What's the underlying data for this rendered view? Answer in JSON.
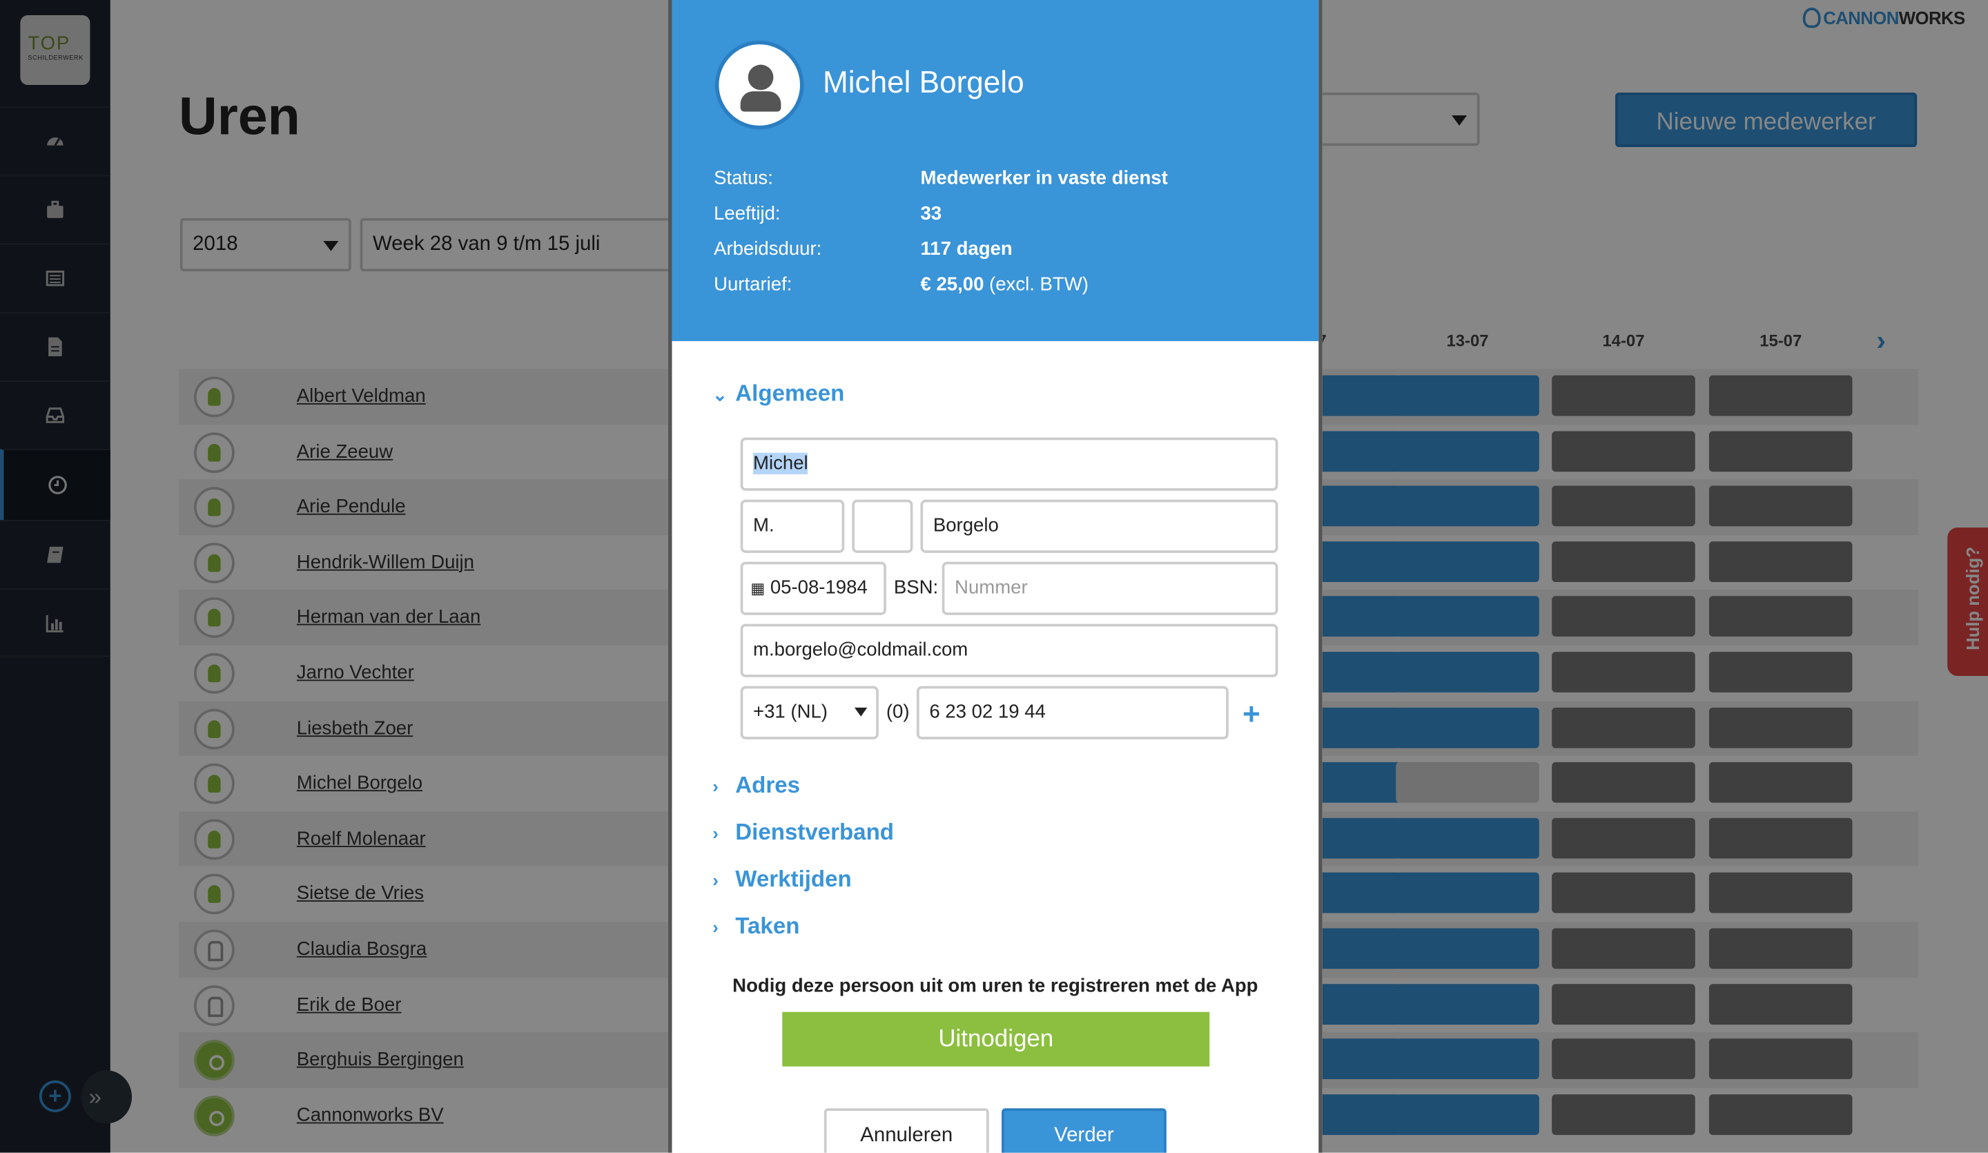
{
  "brand": {
    "logo_top": "TOP",
    "logo_sub": "SCHILDERWERK",
    "app_name_part1": "CANNON",
    "app_name_part2": "WORKS"
  },
  "sidebar": {
    "items": [
      {
        "name": "dashboard-icon"
      },
      {
        "name": "briefcase-icon"
      },
      {
        "name": "list-icon"
      },
      {
        "name": "document-icon"
      },
      {
        "name": "inbox-icon"
      },
      {
        "name": "clock-icon",
        "active": true
      },
      {
        "name": "book-icon"
      },
      {
        "name": "bar-chart-icon"
      }
    ],
    "add_label": "+",
    "collapse_label": "»"
  },
  "page": {
    "title": "Uren",
    "new_button": "Nieuwe medewerker",
    "help_tab": "Hulp nodig?"
  },
  "filters": {
    "year": "2018",
    "week": "Week 28 van 9 t/m 15 juli",
    "third_select": ""
  },
  "dates": [
    "7",
    "13-07",
    "14-07",
    "15-07"
  ],
  "employees": [
    {
      "name": "Albert Veldman",
      "avatar": "green",
      "cells": [
        "blue",
        "blue",
        "gray",
        "gray"
      ]
    },
    {
      "name": "Arie Zeeuw",
      "avatar": "green",
      "cells": [
        "blue",
        "blue",
        "gray",
        "gray"
      ]
    },
    {
      "name": "Arie Pendule",
      "avatar": "green",
      "cells": [
        "blue",
        "blue",
        "gray",
        "gray"
      ]
    },
    {
      "name": "Hendrik-Willem Duijn",
      "avatar": "green",
      "cells": [
        "blue",
        "blue",
        "gray",
        "gray"
      ]
    },
    {
      "name": "Herman van der Laan",
      "avatar": "green",
      "cells": [
        "blue",
        "blue",
        "gray",
        "gray"
      ]
    },
    {
      "name": "Jarno Vechter",
      "avatar": "green",
      "cells": [
        "blue",
        "blue",
        "gray",
        "gray"
      ]
    },
    {
      "name": "Liesbeth Zoer",
      "avatar": "green",
      "cells": [
        "blue",
        "blue",
        "gray",
        "gray"
      ]
    },
    {
      "name": "Michel Borgelo",
      "avatar": "green",
      "cells": [
        "blue",
        "light",
        "gray",
        "gray"
      ]
    },
    {
      "name": "Roelf Molenaar",
      "avatar": "green",
      "cells": [
        "blue",
        "blue",
        "gray",
        "gray"
      ]
    },
    {
      "name": "Sietse de Vries",
      "avatar": "green",
      "cells": [
        "blue",
        "blue",
        "gray",
        "gray"
      ]
    },
    {
      "name": "Claudia Bosgra",
      "avatar": "outline",
      "cells": [
        "blue",
        "blue",
        "gray",
        "gray"
      ]
    },
    {
      "name": "Erik de Boer",
      "avatar": "outline",
      "cells": [
        "blue",
        "blue",
        "gray",
        "gray"
      ]
    },
    {
      "name": "Berghuis Bergingen",
      "avatar": "filled",
      "cells": [
        "blue",
        "blue",
        "gray",
        "gray"
      ]
    },
    {
      "name": "Cannonworks BV",
      "avatar": "filled",
      "cells": [
        "blue",
        "blue",
        "gray",
        "gray"
      ]
    }
  ],
  "modal": {
    "name": "Michel Borgelo",
    "info": [
      {
        "label": "Status:",
        "value": "Medewerker in vaste dienst",
        "extra": ""
      },
      {
        "label": "Leeftijd:",
        "value": "33",
        "extra": ""
      },
      {
        "label": "Arbeidsduur:",
        "value": "117 dagen",
        "extra": ""
      },
      {
        "label": "Uurtarief:",
        "value": "€ 25,00",
        "extra": " (excl. BTW)"
      }
    ],
    "section_general": "Algemeen",
    "first_name": "Michel",
    "initials": "M.",
    "infix": "",
    "last_name": "Borgelo",
    "birthdate": "05-08-1984",
    "bsn_label": "BSN:",
    "bsn_placeholder": "Nummer",
    "email": "m.borgelo@coldmail.com",
    "country_code": "+31 (NL)",
    "zero": "(0)",
    "phone": "6 23 02 19 44",
    "add_phone": "+",
    "sections": [
      "Adres",
      "Dienstverband",
      "Werktijden",
      "Taken"
    ],
    "invite_text": "Nodig deze persoon uit om uren te registreren met de App",
    "invite_button": "Uitnodigen",
    "cancel_button": "Annuleren",
    "next_button": "Verder"
  },
  "colors": {
    "accent": "#3a94d8",
    "green": "#8cbf3f",
    "sidebar": "#1e2530",
    "help": "#e64545"
  }
}
